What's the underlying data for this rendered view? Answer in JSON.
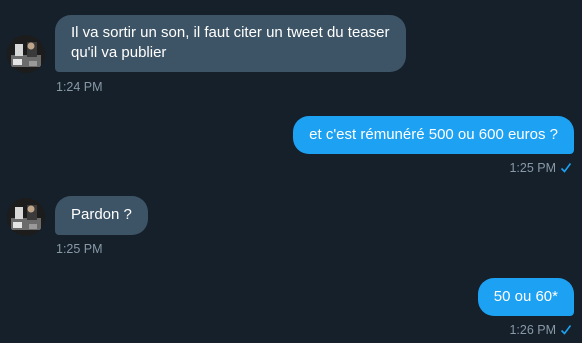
{
  "messages": [
    {
      "direction": "incoming",
      "lines": [
        "Il va sortir un son, il faut citer un tweet du teaser",
        "qu'il va publier"
      ],
      "time": "1:24 PM"
    },
    {
      "direction": "outgoing",
      "text": "et c'est rémunéré 500 ou 600 euros ?",
      "time": "1:25 PM",
      "status_icon": "checkmark-icon"
    },
    {
      "direction": "incoming",
      "text": "Pardon ?",
      "time": "1:25 PM"
    },
    {
      "direction": "outgoing",
      "text": "50 ou 60*",
      "time": "1:26 PM",
      "status_icon": "checkmark-icon"
    }
  ],
  "colors": {
    "background": "#15202b",
    "incoming_bubble": "#3d5466",
    "outgoing_bubble": "#1da1f2",
    "timestamp": "#8899a6"
  }
}
